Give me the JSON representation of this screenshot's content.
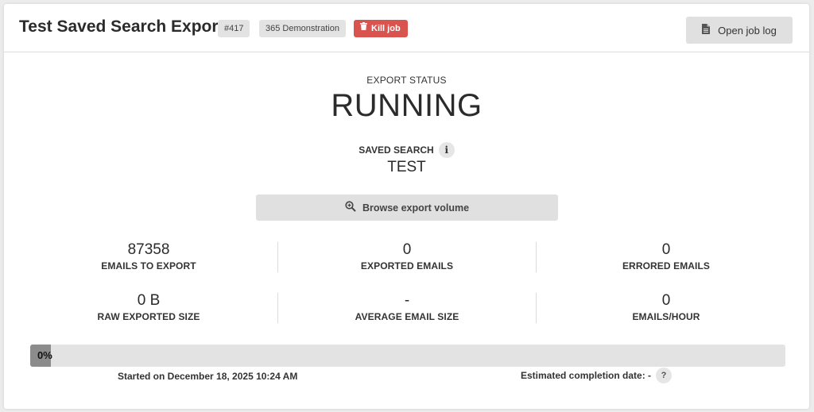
{
  "header": {
    "title": "Test Saved Search Export",
    "job_id_badge": "#417",
    "tenant_badge": "365 Demonstration",
    "kill_label": "Kill job",
    "log_label": "Open job log",
    "colors": {
      "kill": "#d9534f",
      "badge": "#e3e3e3"
    }
  },
  "status": {
    "label": "EXPORT STATUS",
    "value": "RUNNING"
  },
  "saved_search": {
    "label": "SAVED SEARCH",
    "info_icon": "info-icon",
    "value": "TEST"
  },
  "browse": {
    "label": "Browse export volume",
    "icon": "zoom-in-icon"
  },
  "stats": [
    {
      "value": "87358",
      "label": "EMAILS TO EXPORT"
    },
    {
      "value": "0",
      "label": "EXPORTED EMAILS"
    },
    {
      "value": "0",
      "label": "ERRORED EMAILS"
    },
    {
      "value": "0 B",
      "label": "RAW EXPORTED SIZE"
    },
    {
      "value": "-",
      "label": "AVERAGE EMAIL SIZE"
    },
    {
      "value": "0",
      "label": "EMAILS/HOUR"
    }
  ],
  "progress": {
    "percent_text": "0%",
    "fraction": 0.0
  },
  "footer": {
    "started": "Started on December 18, 2025 10:24 AM",
    "estimate": "Estimated completion date: -",
    "help_icon": "help-icon"
  }
}
